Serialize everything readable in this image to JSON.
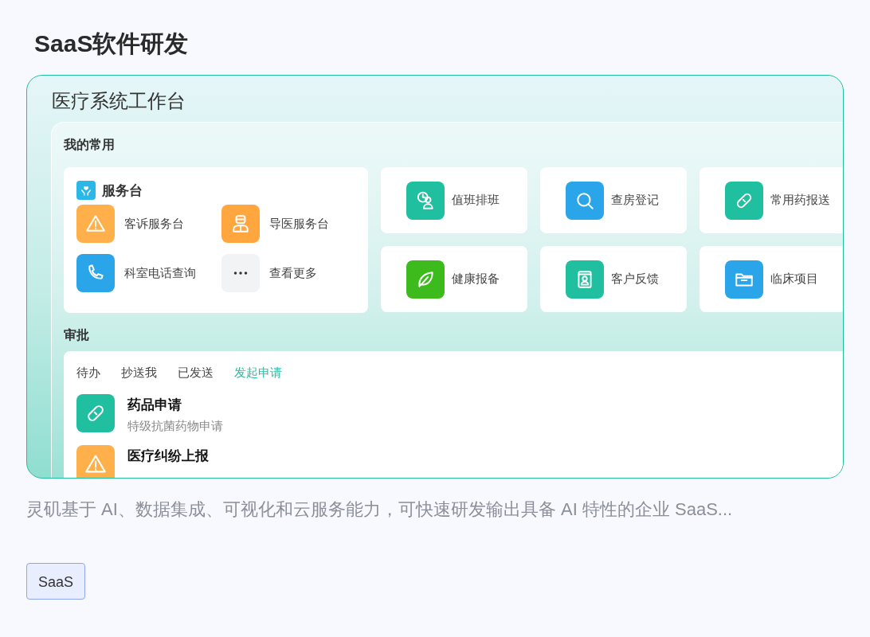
{
  "page_title": "SaaS软件研发",
  "preview": {
    "title": "医疗系统工作台",
    "favorites": {
      "heading": "我的常用",
      "service_desk": {
        "title": "服务台",
        "color": "#2bb8e8",
        "items": [
          {
            "label": "客诉服务台",
            "color": "#ffb04a"
          },
          {
            "label": "导医服务台",
            "color": "#ffa63f"
          },
          {
            "label": "科室电话查询",
            "color": "#2aa5ea"
          },
          {
            "label": "查看更多",
            "color": "#f2f3f5"
          }
        ]
      },
      "shortcuts": [
        {
          "label": "值班排班",
          "color": "#1fbf9f"
        },
        {
          "label": "查房登记",
          "color": "#2aa5ea"
        },
        {
          "label": "常用药报送",
          "color": "#1fbf9f"
        },
        {
          "label": "健康报备",
          "color": "#3dbb1c"
        },
        {
          "label": "客户反馈",
          "color": "#1fbf9f"
        },
        {
          "label": "临床项目",
          "color": "#2aa5ea"
        }
      ]
    },
    "approval": {
      "heading": "审批",
      "tabs": [
        {
          "label": "待办",
          "selected": false
        },
        {
          "label": "抄送我",
          "selected": false
        },
        {
          "label": "已发送",
          "selected": false
        },
        {
          "label": "发起申请",
          "selected": true
        }
      ],
      "items": [
        {
          "title": "药品申请",
          "subtitle": "特级抗菌药物申请",
          "color": "#1fbf9f"
        },
        {
          "title": "医疗纠纷上报",
          "color": "#ffb04a"
        }
      ]
    }
  },
  "description": "灵矶基于 AI、数据集成、可视化和云服务能力，可快速研发输出具备 AI 特性的企业 SaaS...",
  "tags": [
    "SaaS"
  ]
}
